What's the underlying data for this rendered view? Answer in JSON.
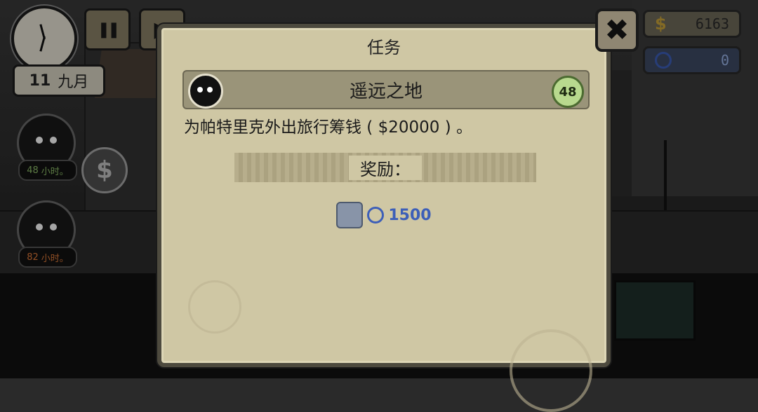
{
  "hud": {
    "date_day": "11",
    "date_month": "九月",
    "pause_glyph": "❚❚",
    "fast_forward_glyph": "▶",
    "money_icon": "$",
    "money": "6163",
    "tokens": "0"
  },
  "characters": [
    {
      "hours": "48",
      "unit": "小时。"
    },
    {
      "hours": "82",
      "unit": "小时。"
    }
  ],
  "coin_glyph": "$",
  "dialog": {
    "title": "任务",
    "close_glyph": "✖",
    "mission_name": "遥远之地",
    "level": "48",
    "description": "为帕特里克外出旅行筹钱 ( $20000 ) 。",
    "reward_label": "奖励：",
    "reward_amount": "1500"
  },
  "colors": {
    "parchment": "#cfc7a4",
    "token_blue": "#3d5fb8",
    "level_green": "#b8d98e",
    "hours_green": "#8fbf6a",
    "hours_orange": "#e07a3a"
  },
  "icons": [
    "clock-icon",
    "pause-icon",
    "fast-forward-icon",
    "dollar-icon",
    "token-icon",
    "character-head-icon",
    "shield-icon",
    "close-icon"
  ]
}
